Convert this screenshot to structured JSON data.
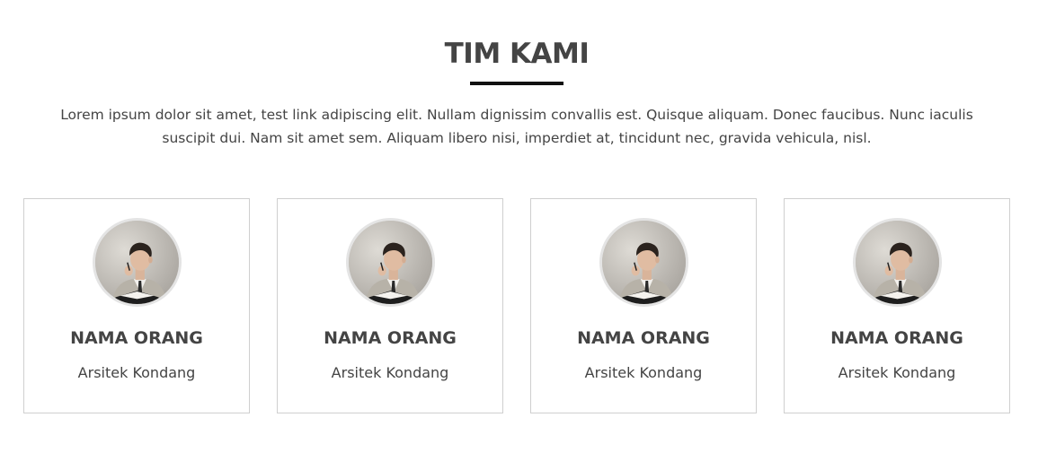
{
  "section": {
    "title": "TIM KAMI",
    "intro": "Lorem ipsum dolor sit amet, test link adipiscing elit. Nullam dignissim convallis est. Quisque aliquam. Donec faucibus. Nunc iaculis suscipit dui. Nam sit amet sem. Aliquam libero nisi, imperdiet at, tincidunt nec, gravida vehicula, nisl."
  },
  "team": [
    {
      "name": "NAMA ORANG",
      "role": "Arsitek Kondang",
      "photo": "man-thinking-with-book-photo"
    },
    {
      "name": "NAMA ORANG",
      "role": "Arsitek Kondang",
      "photo": "man-thinking-with-book-photo"
    },
    {
      "name": "NAMA ORANG",
      "role": "Arsitek Kondang",
      "photo": "man-thinking-with-book-photo"
    },
    {
      "name": "NAMA ORANG",
      "role": "Arsitek Kondang",
      "photo": "man-thinking-with-book-photo"
    }
  ],
  "colors": {
    "text": "#444444",
    "underline": "#111111",
    "card_border": "#cfcfcf"
  }
}
